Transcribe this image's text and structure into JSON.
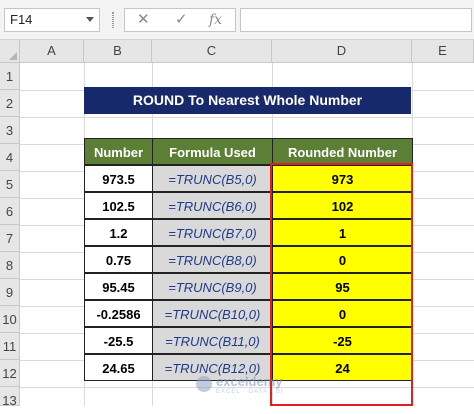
{
  "formula_bar": {
    "name_box": "F14",
    "cancel_icon": "✕",
    "enter_icon": "✓",
    "fx_label": "fx",
    "formula": ""
  },
  "columns": [
    "A",
    "B",
    "C",
    "D",
    "E"
  ],
  "rows": [
    "1",
    "2",
    "3",
    "4",
    "5",
    "6",
    "7",
    "8",
    "9",
    "10",
    "11",
    "12",
    "13"
  ],
  "title": "ROUND To Nearest Whole Number",
  "table": {
    "headers": [
      "Number",
      "Formula Used",
      "Rounded Number"
    ],
    "rows": [
      {
        "number": "973.5",
        "formula": "=TRUNC(B5,0)",
        "rounded": "973"
      },
      {
        "number": "102.5",
        "formula": "=TRUNC(B6,0)",
        "rounded": "102"
      },
      {
        "number": "1.2",
        "formula": "=TRUNC(B7,0)",
        "rounded": "1"
      },
      {
        "number": "0.75",
        "formula": "=TRUNC(B8,0)",
        "rounded": "0"
      },
      {
        "number": "95.45",
        "formula": "=TRUNC(B9,0)",
        "rounded": "95"
      },
      {
        "number": "-0.2586",
        "formula": "=TRUNC(B10,0)",
        "rounded": "0"
      },
      {
        "number": "-25.5",
        "formula": "=TRUNC(B11,0)",
        "rounded": "-25"
      },
      {
        "number": "24.65",
        "formula": "=TRUNC(B12,0)",
        "rounded": "24"
      }
    ]
  },
  "watermark": {
    "brand": "exceldemy",
    "tagline": "EXCEL · DATA · BI"
  },
  "colors": {
    "title_bg": "#17296b",
    "header_bg": "#5b7f35",
    "formula_bg": "#d9d9d9",
    "result_bg": "#ffff00",
    "highlight_border": "#e02020"
  }
}
